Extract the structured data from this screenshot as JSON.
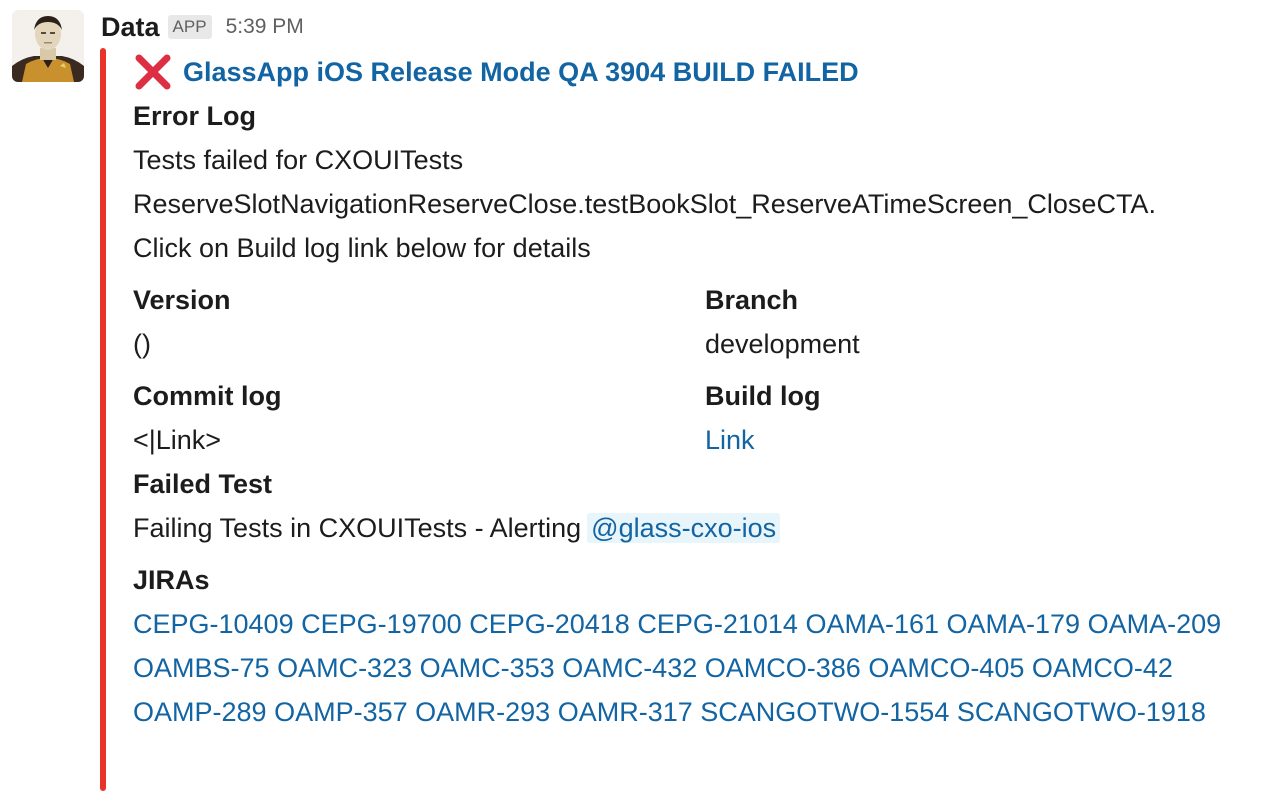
{
  "message": {
    "sender": "Data",
    "badge": "APP",
    "timestamp": "5:39 PM",
    "accent_color": "#e8332a"
  },
  "attachment": {
    "status_icon": "red-x-icon",
    "title": "GlassApp iOS Release Mode QA 3904 BUILD FAILED",
    "error_log": {
      "title": "Error Log",
      "lines": [
        "Tests failed for CXOUITests",
        "ReserveSlotNavigationReserveClose.testBookSlot_ReserveATimeScreen_CloseCTA.",
        "Click on Build log link below for details"
      ]
    },
    "version": {
      "title": "Version",
      "value": "()"
    },
    "branch": {
      "title": "Branch",
      "value": "development"
    },
    "commit_log": {
      "title": "Commit log",
      "value": "<|Link>"
    },
    "build_log": {
      "title": "Build log",
      "value": "Link"
    },
    "failed_test": {
      "title": "Failed Test",
      "text": "Failing Tests in CXOUITests - Alerting",
      "mention": "@glass-cxo-ios"
    },
    "jiras": {
      "title": "JIRAs",
      "items": [
        "CEPG-10409",
        "CEPG-19700",
        "CEPG-20418",
        "CEPG-21014",
        "OAMA-161",
        "OAMA-179",
        "OAMA-209",
        "OAMBS-75",
        "OAMC-323",
        "OAMC-353",
        "OAMC-432",
        "OAMCO-386",
        "OAMCO-405",
        "OAMCO-42",
        "OAMP-289",
        "OAMP-357",
        "OAMR-293",
        "OAMR-317",
        "SCANGOTWO-1554",
        "SCANGOTWO-1918"
      ]
    }
  }
}
